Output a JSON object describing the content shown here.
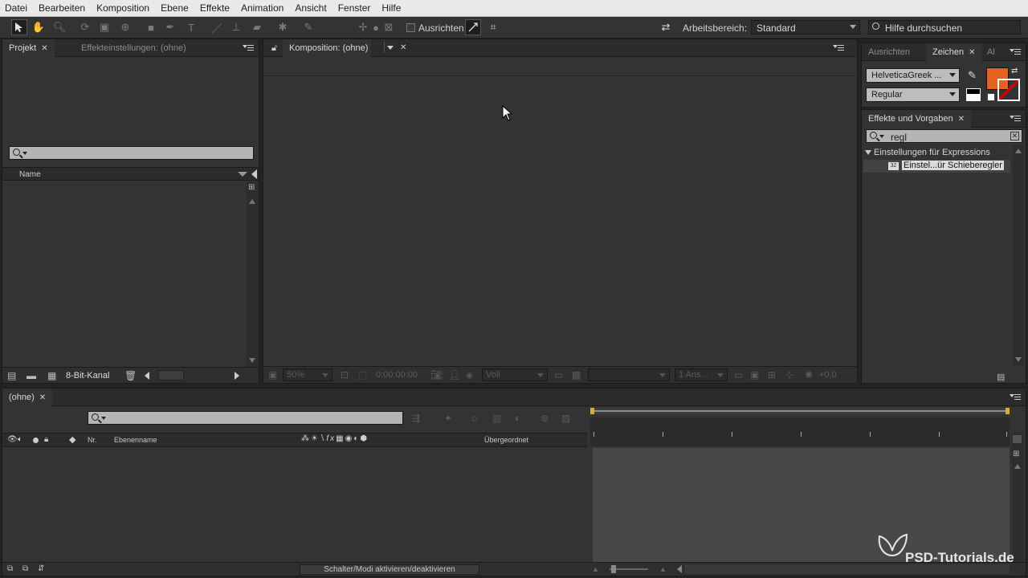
{
  "menu": [
    "Datei",
    "Bearbeiten",
    "Komposition",
    "Ebene",
    "Effekte",
    "Animation",
    "Ansicht",
    "Fenster",
    "Hilfe"
  ],
  "toolbar": {
    "align_label": "Ausrichten",
    "workspace_label": "Arbeitsbereich:",
    "workspace_value": "Standard",
    "help_search_placeholder": "Hilfe durchsuchen"
  },
  "project_panel": {
    "tabs": [
      {
        "label": "Projekt",
        "active": true
      },
      {
        "label": "Effekteinstellungen: (ohne)",
        "active": false
      }
    ],
    "column_name": "Name",
    "bit_depth": "8-Bit-Kanal"
  },
  "composition_panel": {
    "tab_label": "Komposition: (ohne)",
    "footer": {
      "zoom": "50%",
      "timecode": "0:00:00:00",
      "resolution": "Voll",
      "views": "1 Ans...",
      "exposure": "+0,0"
    }
  },
  "right_panels": {
    "tabs": [
      {
        "label": "Ausrichten",
        "active": false
      },
      {
        "label": "Zeichen",
        "active": true
      },
      {
        "label": "Al",
        "active": false
      }
    ],
    "font_family": "HelveticaGreek ...",
    "font_style": "Regular",
    "fill_color": "#e8621f",
    "effects": {
      "tab_label": "Effekte und Vorgaben",
      "search_value": "regl",
      "category": "Einstellungen für Expressions",
      "item": "Einstel...ür Schieberegler"
    }
  },
  "timeline": {
    "tab_label": "(ohne)",
    "columns": {
      "nr": "Nr.",
      "layer_name": "Ebenenname",
      "parent": "Übergeordnet"
    },
    "footer_toggle": "Schalter/Modi aktivieren/deaktivieren"
  },
  "watermark": "PSD-Tutorials.de",
  "colors": {
    "panel_bg": "#333333",
    "accent_orange": "#e8621f",
    "timeline_marker": "#d4b02a"
  }
}
